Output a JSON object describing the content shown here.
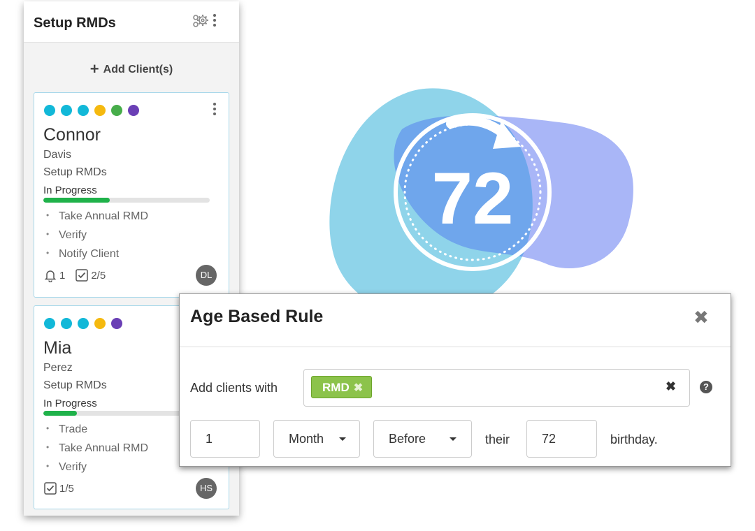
{
  "panel": {
    "title": "Setup RMDs",
    "header_icons": [
      "gears-icon",
      "kebab-menu-icon"
    ],
    "add_client_label": "Add Client(s)",
    "cards": [
      {
        "dot_colors": [
          "#12b8d8",
          "#12b8d8",
          "#12b8d8",
          "#f5b90f",
          "#47ad4a",
          "#6a3fb5"
        ],
        "first_name": "Connor",
        "last_name": "Davis",
        "workflow": "Setup RMDs",
        "status": "In Progress",
        "progress": 0.4,
        "tasks": [
          "Take Annual RMD",
          "Verify",
          "Notify Client"
        ],
        "alerts": "1",
        "checklist": "2/5",
        "avatar": "DL"
      },
      {
        "dot_colors": [
          "#12b8d8",
          "#12b8d8",
          "#12b8d8",
          "#f5b90f",
          "#6a3fb5"
        ],
        "first_name": "Mia",
        "last_name": "Perez",
        "workflow": "Setup RMDs",
        "status": "In Progress",
        "progress": 0.2,
        "tasks": [
          "Trade",
          "Take Annual RMD",
          "Verify"
        ],
        "checklist": "1/5",
        "avatar": "HS"
      }
    ]
  },
  "illustration": {
    "number": "72",
    "colors": {
      "blob_light": "#8fd4ea",
      "blob_purple": "#a9b6f7",
      "overlap": "#6fa6ec"
    }
  },
  "modal": {
    "title": "Age Based Rule",
    "add_clients_label": "Add clients with",
    "tag": "RMD",
    "tag_color": "#8cc34b",
    "offset_value": "1",
    "unit_selected": "Month",
    "relation_selected": "Before",
    "their_label": "their",
    "age_value": "72",
    "birthday_label": "birthday."
  }
}
